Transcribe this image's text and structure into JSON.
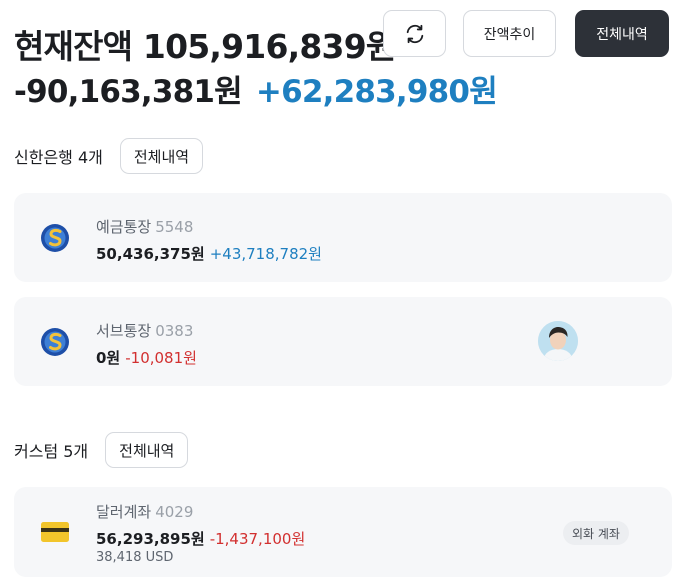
{
  "header": {
    "title": "현재잔액 105,916,839원",
    "refresh_icon": "refresh-icon",
    "trend_label": "잔액추이",
    "all_label": "전체내역"
  },
  "summary": {
    "negative": "-90,163,381원",
    "positive": "+62,283,980원"
  },
  "groups": [
    {
      "name": "신한은행 4개",
      "all_label": "전체내역",
      "accounts": [
        {
          "name": "예금통장",
          "number": "5548",
          "balance": "50,436,375원",
          "delta": "+43,718,782원",
          "logo": "shinhan-logo-icon"
        },
        {
          "name": "서브통장",
          "number": "0383",
          "balance": "0원",
          "delta": "-10,081원",
          "logo": "shinhan-logo-icon",
          "avatar": "profile-avatar"
        }
      ]
    },
    {
      "name": "커스텀 5개",
      "all_label": "전체내역",
      "accounts": [
        {
          "name": "달러계좌",
          "number": "4029",
          "balance": "56,293,895원",
          "delta": "-1,437,100원",
          "sub": "38,418 USD",
          "tag": "외화 계좌",
          "logo": "card-icon"
        }
      ]
    }
  ],
  "colors": {
    "positive": "#1e7fc0",
    "negative": "#d23030",
    "dark_button": "#2d3138",
    "card_bg": "#f6f7f9"
  }
}
